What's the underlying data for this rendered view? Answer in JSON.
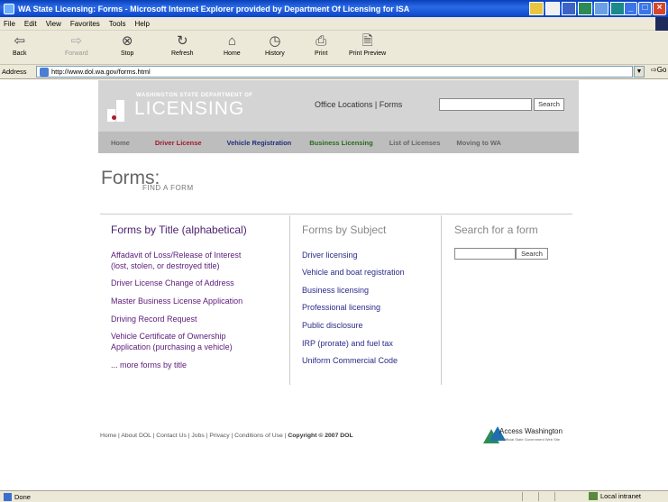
{
  "window": {
    "title": "WA State Licensing: Forms - Microsoft Internet Explorer provided by Department Of Licensing for ISA",
    "controls": [
      "_",
      "□",
      "×"
    ]
  },
  "menu": [
    "File",
    "Edit",
    "View",
    "Favorites",
    "Tools",
    "Help"
  ],
  "toolbar": {
    "back": "Back",
    "forward": "Forward",
    "stop": "Stop",
    "refresh": "Refresh",
    "home": "Home",
    "history": "History",
    "print": "Print",
    "print_preview": "Print Preview"
  },
  "address": {
    "label": "Address",
    "url": "http://www.dol.wa.gov/forms.html",
    "go": "Go"
  },
  "site": {
    "logo_small": "WASHINGTON STATE DEPARTMENT OF",
    "logo_big": "LICENSING",
    "header_links": "Office Locations | Forms",
    "search_button": "Search",
    "nav": [
      {
        "label": "Home",
        "color": "#666666"
      },
      {
        "label": "Driver License",
        "color": "#a0182a"
      },
      {
        "label": "Vehicle Registration",
        "color": "#1f2f7a"
      },
      {
        "label": "Business Licensing",
        "color": "#2a6a1a"
      },
      {
        "label": "List of Licenses",
        "color": "#666666"
      },
      {
        "label": "Moving to WA",
        "color": "#666666"
      }
    ]
  },
  "page": {
    "title": "Forms:",
    "subtitle": "FIND A FORM"
  },
  "col_title": {
    "heading": "Forms by Title (alphabetical)",
    "links": [
      "Affadavit of Loss/Release of Interest",
      "(lost, stolen, or destroyed title)",
      "Driver License Change of Address",
      "Master Business License Application",
      "Driving Record Request",
      "Vehicle Certificate of Ownership",
      "Application (purchasing a vehicle)",
      "... more forms by title"
    ]
  },
  "col_subject": {
    "heading": "Forms by Subject",
    "links": [
      "Driver licensing",
      "Vehicle and boat registration",
      "Business licensing",
      "Professional licensing",
      "Public disclosure",
      "IRP (prorate) and fuel tax",
      "Uniform Commercial Code"
    ]
  },
  "col_search": {
    "heading": "Search for a form",
    "button": "Search"
  },
  "footer": {
    "links": [
      "Home",
      "About DOL",
      "Contact Us",
      "Jobs",
      "Privacy",
      "Conditions of Use"
    ],
    "copyright": "Copyright © 2007 DOL",
    "access_wa": "Access Washington",
    "access_wa_tag": "Official State Government Web Site"
  },
  "status": {
    "text": "Done",
    "zone": "Local intranet"
  },
  "colors": {
    "link": "#5b1a7a",
    "subject_link": "#2a2a8a",
    "heading_title": "#4a1e6e",
    "heading_muted": "#888888"
  }
}
